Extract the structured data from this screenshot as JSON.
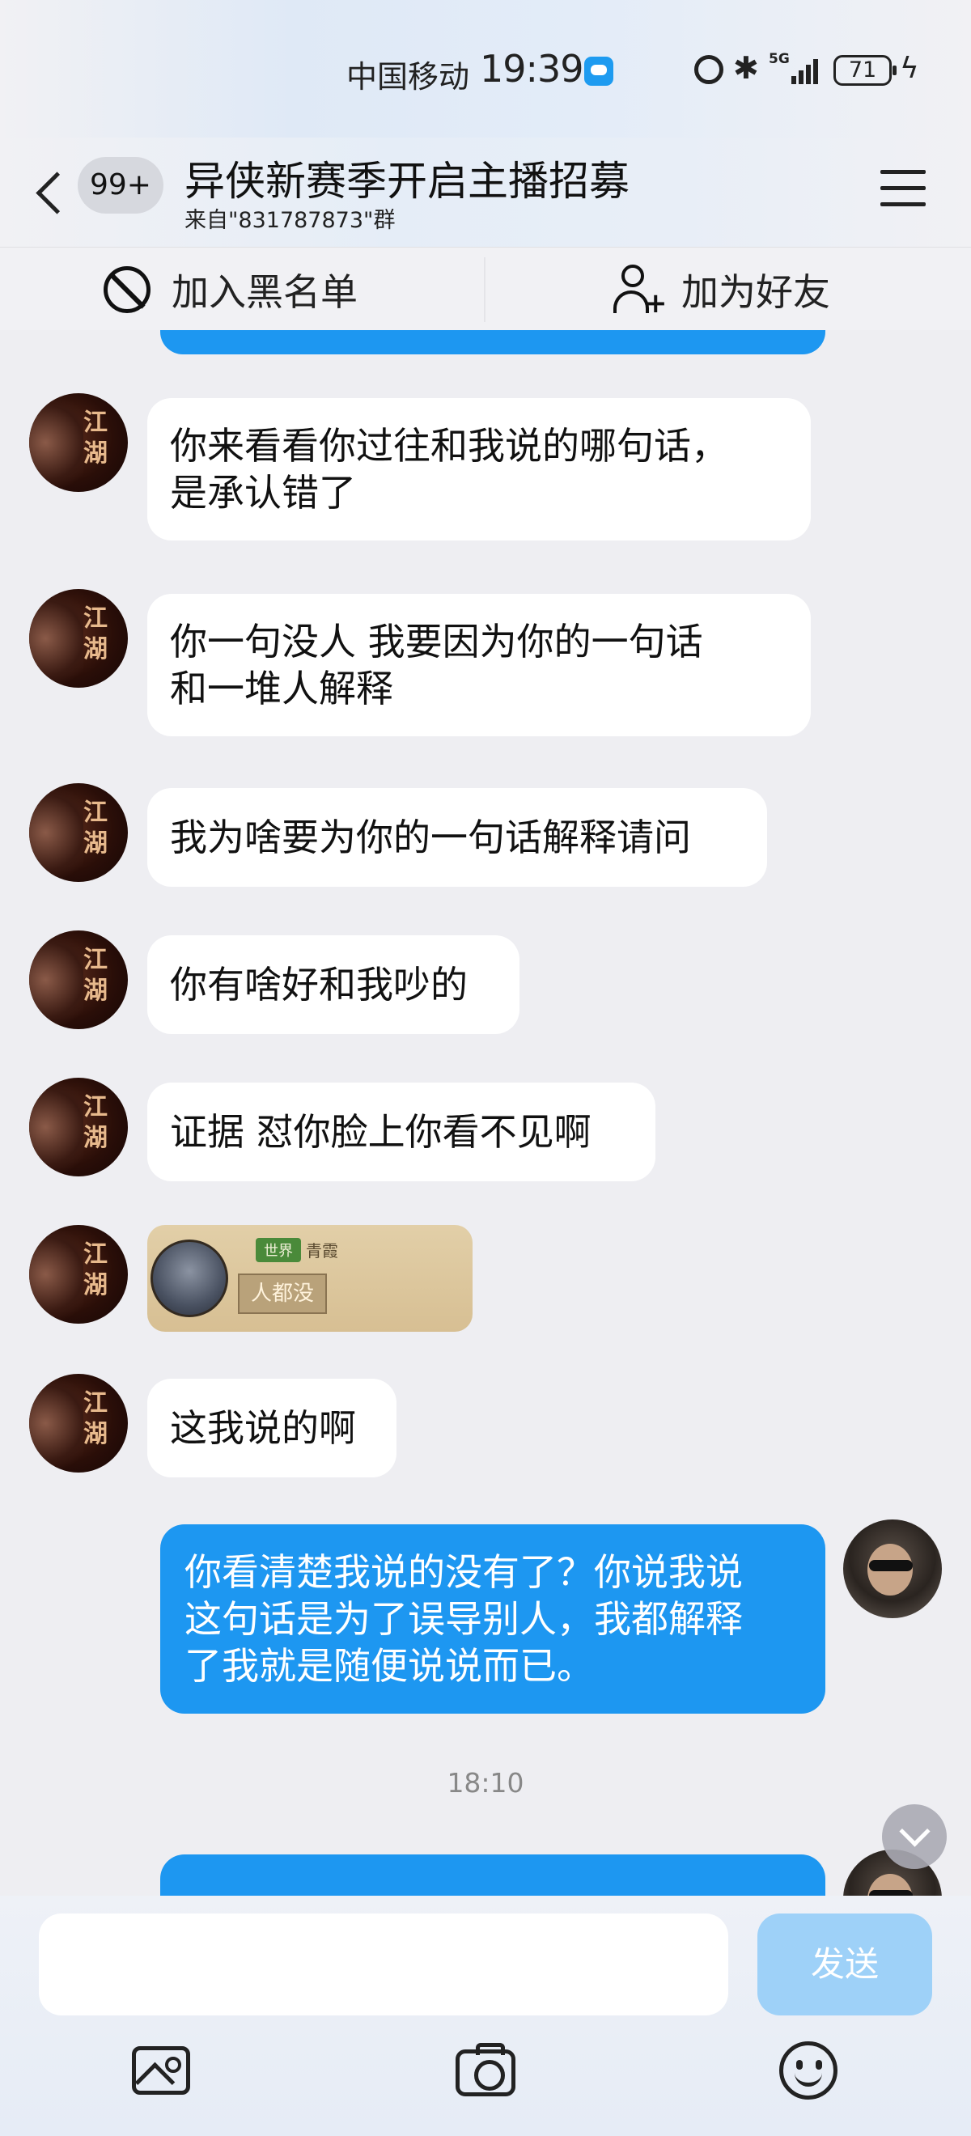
{
  "status_bar": {
    "carrier": "中国移动",
    "time": "19:39",
    "network": "5G",
    "battery": "71"
  },
  "header": {
    "unread_count": "99+",
    "title": "异侠新赛季开启主播招募",
    "subtitle": "来自\"831787873\"群"
  },
  "actions": {
    "blacklist_label": "加入黑名单",
    "add_friend_label": "加为好友"
  },
  "messages": [
    {
      "side": "in",
      "text_lines": [
        "你来看看你过往和我说的哪句话，",
        "是承认错了"
      ]
    },
    {
      "side": "in",
      "text_lines": [
        "你一句没人 我要因为你的一句话",
        "和一堆人解释"
      ]
    },
    {
      "side": "in",
      "text_lines": [
        "我为啥要为你的一句话解释请问"
      ]
    },
    {
      "side": "in",
      "text_lines": [
        "你有啥好和我吵的"
      ]
    },
    {
      "side": "in",
      "text_lines": [
        "证据 怼你脸上你看不见啊"
      ]
    },
    {
      "side": "in",
      "type": "image",
      "image": {
        "channel_tag": "世界",
        "sender": "青霞",
        "text": "人都没"
      }
    },
    {
      "side": "in",
      "text_lines": [
        "这我说的啊"
      ]
    },
    {
      "side": "out",
      "text_lines": [
        "你看清楚我说的没有了？你说我说",
        "这句话是为了误导别人，我都解释",
        "了我就是随便说说而已。"
      ]
    }
  ],
  "timestamp": "18:10",
  "avatar_logo": "江湖",
  "input": {
    "placeholder": "",
    "send_label": "发送"
  },
  "colors": {
    "outgoing_bubble": "#1d97f1",
    "incoming_bubble": "#ffffff",
    "background": "#eeeef2",
    "send_button": "#9ed1f8"
  }
}
